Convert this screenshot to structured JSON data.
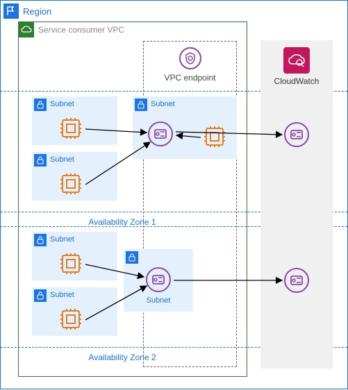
{
  "region": {
    "label": "Region"
  },
  "vpc": {
    "label": "Service consumer VPC"
  },
  "endpoint": {
    "label": "VPC endpoint"
  },
  "az1": {
    "label": "Availability Zone 1"
  },
  "az2": {
    "label": "Availability Zone 2"
  },
  "subnets": {
    "left_a1": "Subnet",
    "left_a2": "Subnet",
    "left_b1": "Subnet",
    "left_b2": "Subnet",
    "ep_a": "Subnet",
    "ep_b": "Subnet"
  },
  "cloudwatch": {
    "label": "CloudWatch"
  }
}
